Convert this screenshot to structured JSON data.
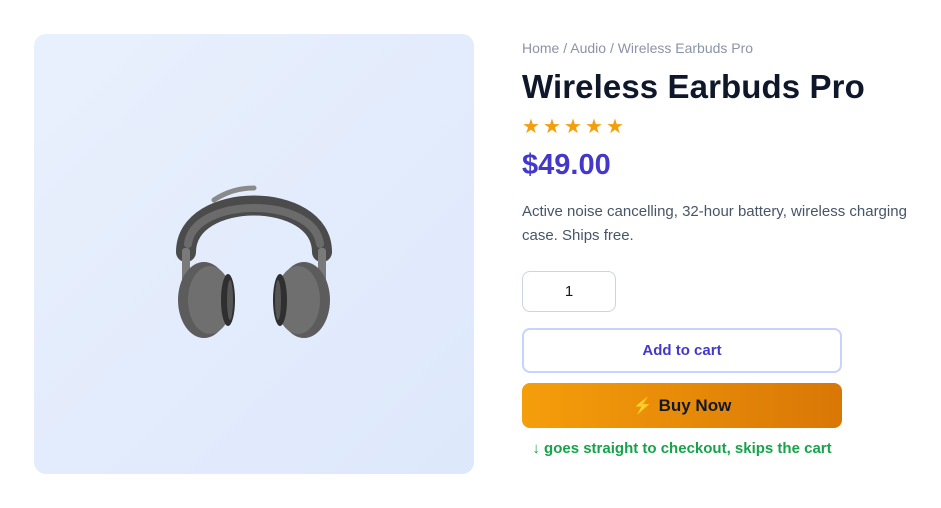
{
  "breadcrumb": "Home / Audio / Wireless Earbuds Pro",
  "product": {
    "title": "Wireless Earbuds Pro",
    "rating": 5,
    "rating_max": 5,
    "stars": [
      "★",
      "★",
      "★",
      "★",
      "★"
    ],
    "price": "$49.00",
    "description": "Active noise cancelling, 32-hour battery, wireless charging case. Ships free.",
    "image_icon": "headphones-icon"
  },
  "quantity": {
    "value": "1"
  },
  "actions": {
    "add_to_cart_label": "Add to cart",
    "buy_now_icon": "⚡",
    "buy_now_label": "Buy Now",
    "buy_now_note": "↓ goes straight to checkout, skips the cart"
  },
  "colors": {
    "accent": "#4338ca",
    "buy_now_start": "#f59e0b",
    "buy_now_end": "#d97706",
    "note_green": "#16a34a",
    "star": "#f59e0b"
  }
}
